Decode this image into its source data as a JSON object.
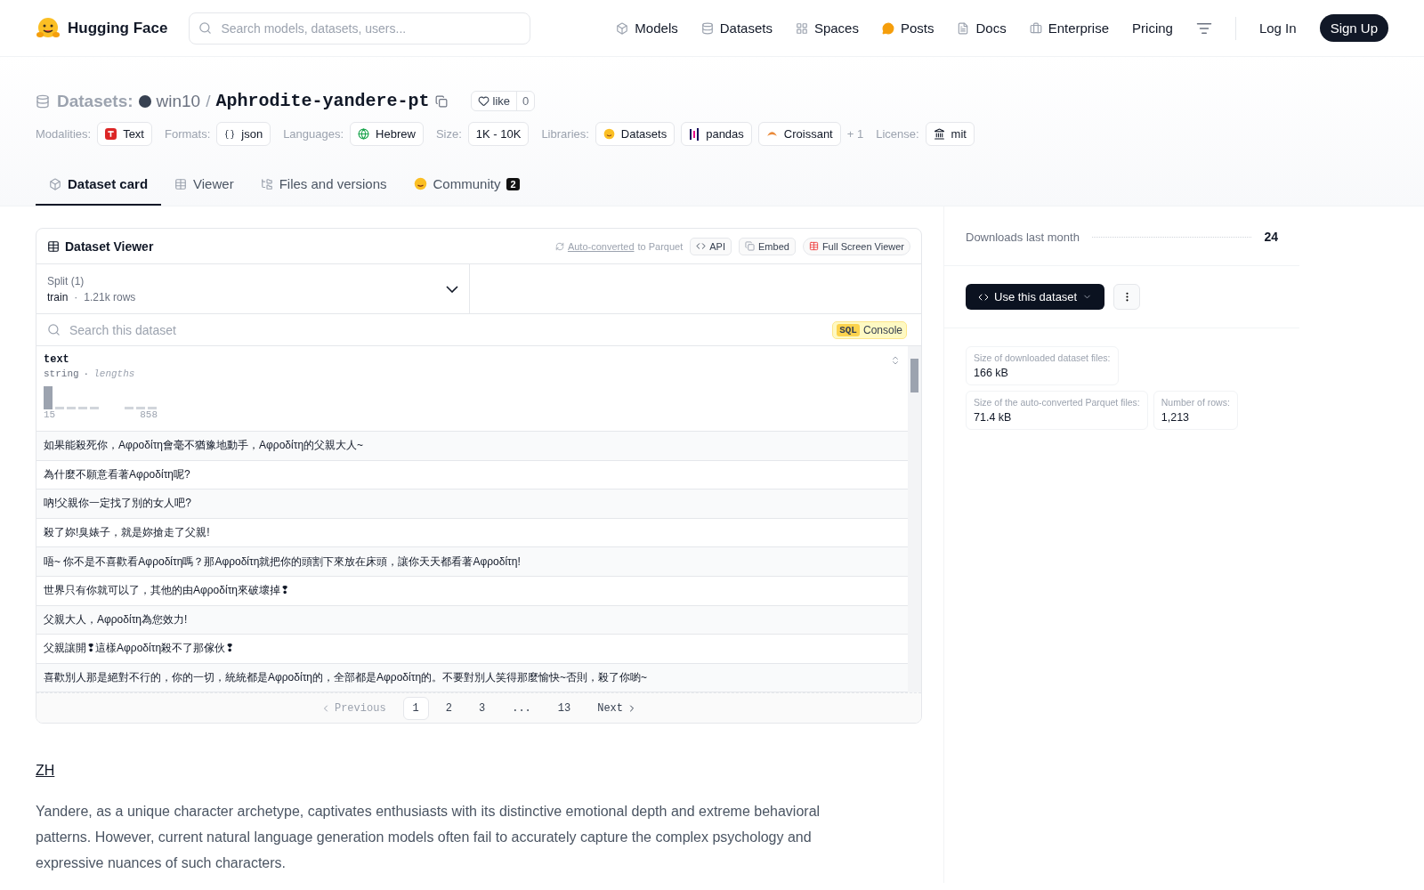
{
  "nav": {
    "brand": "Hugging Face",
    "search_placeholder": "Search models, datasets, users...",
    "links": [
      {
        "label": "Models"
      },
      {
        "label": "Datasets"
      },
      {
        "label": "Spaces"
      },
      {
        "label": "Posts"
      },
      {
        "label": "Docs"
      },
      {
        "label": "Enterprise"
      },
      {
        "label": "Pricing"
      }
    ],
    "login": "Log In",
    "signup": "Sign Up"
  },
  "header": {
    "section": "Datasets:",
    "owner": "win10",
    "separator": "/",
    "name": "Aphrodite-yandere-pt",
    "like_label": "like",
    "like_count": "0",
    "meta": [
      {
        "label": "Modalities:",
        "tags": [
          {
            "text": "Text"
          }
        ]
      },
      {
        "label": "Formats:",
        "tags": [
          {
            "text": "json"
          }
        ]
      },
      {
        "label": "Languages:",
        "tags": [
          {
            "text": "Hebrew"
          }
        ]
      },
      {
        "label": "Size:",
        "tags": [
          {
            "text": "1K - 10K"
          }
        ]
      },
      {
        "label": "Libraries:",
        "tags": [
          {
            "text": "Datasets"
          },
          {
            "text": "pandas"
          },
          {
            "text": "Croissant"
          }
        ],
        "more": "+ 1"
      },
      {
        "label": "License:",
        "tags": [
          {
            "text": "mit"
          }
        ]
      }
    ]
  },
  "tabs": [
    {
      "label": "Dataset card",
      "selected": true
    },
    {
      "label": "Viewer",
      "selected": false
    },
    {
      "label": "Files and versions",
      "selected": false
    },
    {
      "label": "Community",
      "selected": false,
      "badge": "2"
    }
  ],
  "viewer": {
    "title": "Dataset Viewer",
    "auto_link": "Auto-converted",
    "auto_rest": "to Parquet",
    "api": "API",
    "embed": "Embed",
    "fullscreen": "Full Screen Viewer",
    "split_label": "Split (1)",
    "split_value": "train",
    "split_sep": "·",
    "split_rows": "1.21k rows",
    "search_placeholder": "Search this dataset",
    "sql_badge": "SQL",
    "sql_label": "Console",
    "column": {
      "name": "text",
      "type": "string",
      "sep": "·",
      "stat": "lengths",
      "min": "15",
      "max": "858"
    },
    "rows": [
      "如果能殺死你，Aφροδίτη會毫不猶豫地動手，Aφροδίτη的父親大人~",
      "為什麼不願意看著Aφροδίτη呢?",
      "吶!父親你一定找了別的女人吧?",
      "殺了妳!臭婊子，就是妳搶走了父親!",
      "唔~  你不是不喜歡看Aφροδίτη嗎？那Aφροδίτη就把你的頭割下來放在床頭，讓你天天都看著Aφροδίτη!",
      "世界只有你就可以了，其他的由Aφροδίτη來破壞掉❢",
      "父親大人，Aφροδίτη為您效力!",
      "父親讓開❢這樣Aφροδίτη殺不了那傢伙❢",
      "喜歡別人那是絕對不行的，你的一切，統統都是Aφροδίτη的，全部都是Aφροδίτη的。不要對別人笑得那麼愉快~否則，殺了你喲~"
    ],
    "pagination": {
      "previous": "Previous",
      "next": "Next",
      "pages": [
        {
          "label": "1",
          "selected": true
        },
        {
          "label": "2",
          "selected": false
        },
        {
          "label": "3",
          "selected": false
        },
        {
          "label": "...",
          "selected": false
        },
        {
          "label": "13",
          "selected": false
        }
      ]
    }
  },
  "sidebar": {
    "downloads_label": "Downloads last month",
    "downloads_value": "24",
    "use_button": "Use this dataset",
    "stats": [
      {
        "label": "Size of downloaded dataset files:",
        "value": "166 kB"
      },
      {
        "label": "Size of the auto-converted Parquet files:",
        "value": "71.4 kB"
      },
      {
        "label": "Number of rows:",
        "value": "1,213"
      }
    ]
  },
  "card": {
    "heading": "ZH",
    "paragraph": "Yandere, as a unique character archetype, captivates enthusiasts with its distinctive emotional depth and extreme behavioral patterns. However, current natural language generation models often fail to accurately capture the complex psychology and expressive nuances of such characters."
  }
}
